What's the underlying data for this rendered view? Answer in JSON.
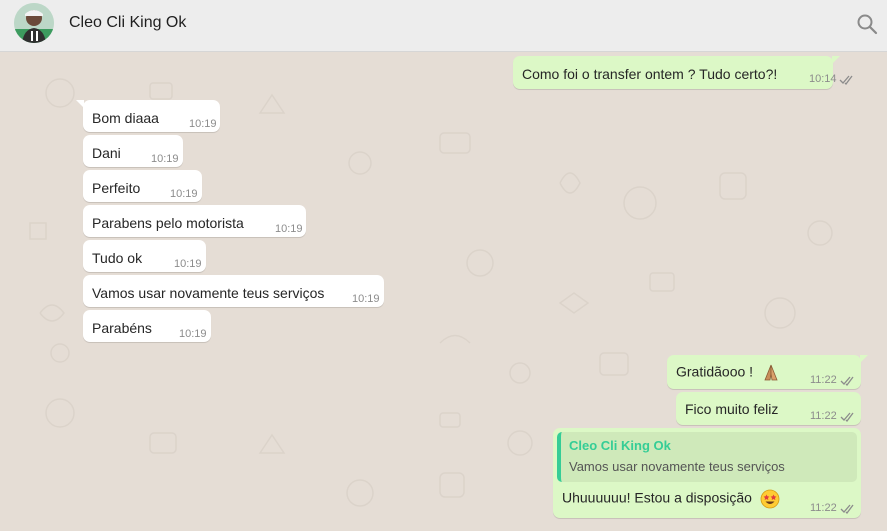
{
  "header": {
    "contact_name": "Cleo Cli King Ok"
  },
  "messages": [
    {
      "direction": "out",
      "text": "Como foi o transfer ontem ? Tudo certo?!",
      "time": "10:14",
      "read": true
    },
    {
      "direction": "in",
      "text": "Bom diaaa",
      "time": "10:19"
    },
    {
      "direction": "in",
      "text": "Dani",
      "time": "10:19"
    },
    {
      "direction": "in",
      "text": "Perfeito",
      "time": "10:19"
    },
    {
      "direction": "in",
      "text": "Parabens pelo motorista",
      "time": "10:19"
    },
    {
      "direction": "in",
      "text": "Tudo ok",
      "time": "10:19"
    },
    {
      "direction": "in",
      "text": "Vamos usar novamente teus serviços",
      "time": "10:19"
    },
    {
      "direction": "in",
      "text": "Parabéns",
      "time": "10:19"
    },
    {
      "direction": "out",
      "text": "Gratidãooo !",
      "emoji": "folded-hands",
      "time": "11:22",
      "read": true
    },
    {
      "direction": "out",
      "text": "Fico muito feliz",
      "time": "11:22",
      "read": true
    },
    {
      "direction": "out",
      "quoted": {
        "author": "Cleo Cli King Ok",
        "text": "Vamos usar novamente teus serviços"
      },
      "text": "Uhuuuuuu! Estou a disposição",
      "emoji": "star-struck",
      "time": "11:22",
      "read": true
    }
  ],
  "colors": {
    "incoming_bubble": "#ffffff",
    "outgoing_bubble": "#dcf8c6",
    "quote_accent": "#35cd96",
    "read_ticks": "#8c8c8c",
    "chat_background": "#e5ddd5",
    "header_background": "#ededed"
  }
}
